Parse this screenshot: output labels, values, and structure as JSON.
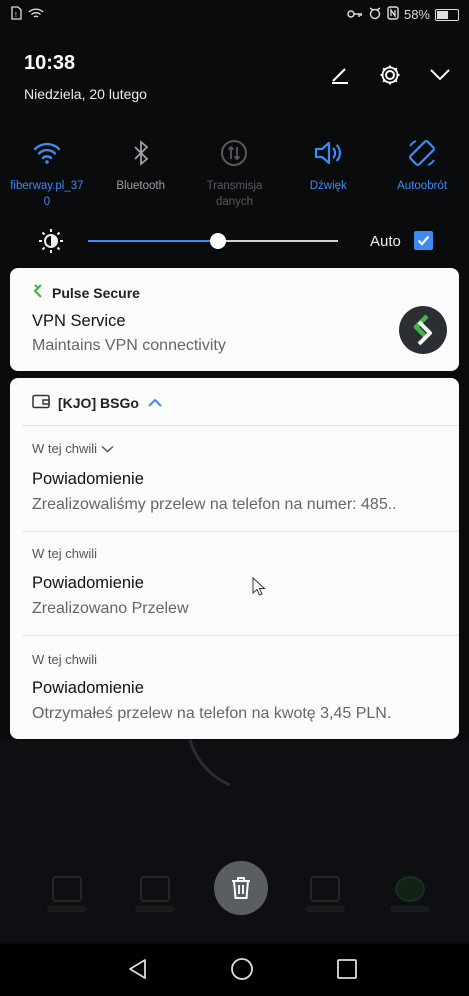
{
  "status_bar": {
    "battery_percent": "58%",
    "battery_level": 0.58
  },
  "header": {
    "time": "10:38",
    "date": "Niedziela, 20 lutego"
  },
  "quick_settings": [
    {
      "label": "fiberway.pl_37\n0",
      "icon": "wifi-icon",
      "state": "on"
    },
    {
      "label": "Bluetooth",
      "icon": "bluetooth-icon",
      "state": "off"
    },
    {
      "label": "Transmisja\ndanych",
      "icon": "mobile-data-icon",
      "state": "disabled"
    },
    {
      "label": "Dźwięk",
      "icon": "sound-icon",
      "state": "on"
    },
    {
      "label": "Autoobrót",
      "icon": "auto-rotate-icon",
      "state": "on"
    }
  ],
  "brightness": {
    "level": 0.52,
    "auto_label": "Auto",
    "auto_checked": true
  },
  "vpn_notification": {
    "app_name": "Pulse Secure",
    "title": "VPN Service",
    "body": "Maintains VPN connectivity"
  },
  "bank_notification": {
    "app_name": "[KJO] BSGo",
    "items": [
      {
        "when": "W tej chwili",
        "title": "Powiadomienie",
        "body": "Zrealizowaliśmy przelew na telefon na numer: 485.."
      },
      {
        "when": "W tej chwili",
        "title": "Powiadomienie",
        "body": "Zrealizowano Przelew"
      },
      {
        "when": "W tej chwili",
        "title": "Powiadomienie",
        "body": "Otrzymałeś przelew na telefon na kwotę 3,45 PLN."
      }
    ]
  },
  "colors": {
    "accent": "#3d8bf2",
    "card_bg": "#fbfbfb",
    "background": "#0a0b0d",
    "pulse_green": "#3fb54a"
  }
}
